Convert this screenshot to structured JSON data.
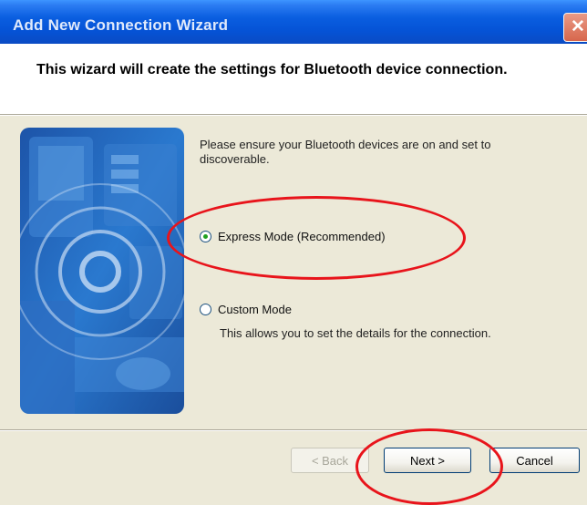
{
  "window": {
    "title": "Add New Connection Wizard",
    "close_glyph": "✕"
  },
  "header": {
    "headline": "This wizard will create the settings for Bluetooth device connection."
  },
  "content": {
    "intro": "Please ensure your Bluetooth devices are on and set to discoverable.",
    "options": [
      {
        "label": "Express Mode (Recommended)",
        "selected": true
      },
      {
        "label": "Custom Mode",
        "selected": false
      }
    ],
    "custom_description": "This allows you to set the details for the connection."
  },
  "buttons": {
    "back": "< Back",
    "next": "Next >",
    "cancel": "Cancel"
  },
  "colors": {
    "annotation": "#e8141b",
    "title_bar": "#0a5ee0",
    "dialog_bg": "#ece9d8"
  },
  "icons": [
    "close-icon",
    "bluetooth-devices-illustration",
    "radio-icon"
  ]
}
